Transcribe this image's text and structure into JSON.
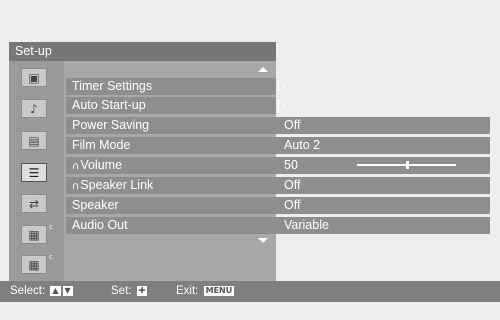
{
  "menu": {
    "title": "Set-up",
    "rail_icons": [
      {
        "icon": "picture-icon",
        "glyph": "▣",
        "selected": false
      },
      {
        "icon": "sound-note-icon",
        "glyph": "♪",
        "selected": false
      },
      {
        "icon": "screen-icon",
        "glyph": "▤",
        "selected": false
      },
      {
        "icon": "setup-icon",
        "glyph": "☰",
        "selected": true
      },
      {
        "icon": "input-icon",
        "glyph": "⇄",
        "selected": false
      },
      {
        "icon": "settings-icon-1",
        "glyph": "▦",
        "selected": false
      },
      {
        "icon": "settings-icon-2",
        "glyph": "▦",
        "selected": false
      }
    ],
    "items": [
      {
        "label": "Timer Settings",
        "has_submenu": true
      },
      {
        "label": "Auto Start-up",
        "has_submenu": true
      },
      {
        "label": "Power Saving",
        "value": "Off"
      },
      {
        "label": "Film Mode",
        "value": "Auto 2"
      },
      {
        "label": "Volume",
        "value": "50",
        "headphone": true,
        "slider_level": 0.5
      },
      {
        "label": "Speaker Link",
        "value": "Off",
        "headphone": true
      },
      {
        "label": "Speaker",
        "value": "Off"
      },
      {
        "label": "Audio Out",
        "value": "Variable"
      }
    ]
  },
  "footer": {
    "select_label": "Select:",
    "set_label": "Set:",
    "exit_label": "Exit:",
    "up_key": "▲",
    "down_key": "▼",
    "set_key": "✚",
    "exit_key": "MENU"
  }
}
